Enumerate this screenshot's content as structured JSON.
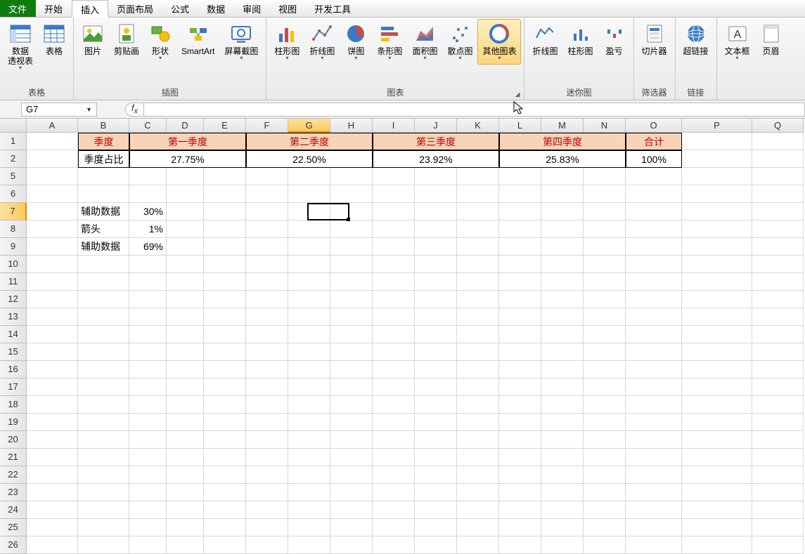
{
  "tabs": {
    "file": "文件",
    "home": "开始",
    "insert": "插入",
    "layout": "页面布局",
    "formula": "公式",
    "data": "数据",
    "review": "审阅",
    "view": "视图",
    "dev": "开发工具"
  },
  "ribbon": {
    "groups": {
      "tables": "表格",
      "illus": "插图",
      "charts": "图表",
      "sparks": "迷你图",
      "filter": "筛选器",
      "links": "链接"
    },
    "btns": {
      "pivot": "数据\n透视表",
      "table": "表格",
      "pic": "图片",
      "clip": "剪贴画",
      "shapes": "形状",
      "smartart": "SmartArt",
      "screenshot": "屏幕截图",
      "col": "柱形图",
      "line": "折线图",
      "pie": "饼图",
      "bar": "条形图",
      "area": "面积图",
      "scatter": "散点图",
      "other": "其他图表",
      "sline": "折线图",
      "scol": "柱形图",
      "swin": "盈亏",
      "slicer": "切片器",
      "hyper": "超链接",
      "textbox": "文本框",
      "header": "页眉"
    }
  },
  "namebox": "G7",
  "cols": [
    "A",
    "B",
    "C",
    "D",
    "E",
    "F",
    "G",
    "H",
    "I",
    "J",
    "K",
    "L",
    "M",
    "N",
    "O",
    "P",
    "Q"
  ],
  "selectedCol": "G",
  "selectedRow": 7,
  "table": {
    "r1": {
      "b": "季度",
      "cde": "第一季度",
      "fgh": "第二季度",
      "ijk": "第三季度",
      "lmn": "第四季度",
      "o": "合计"
    },
    "r2": {
      "b": "季度占比",
      "cde": "27.75%",
      "fgh": "22.50%",
      "ijk": "23.92%",
      "lmn": "25.83%",
      "o": "100%"
    }
  },
  "aux": {
    "r7": {
      "b": "辅助数据",
      "c": "30%"
    },
    "r8": {
      "b": "箭头",
      "c": "1%"
    },
    "r9": {
      "b": "辅助数据",
      "c": "69%"
    }
  }
}
